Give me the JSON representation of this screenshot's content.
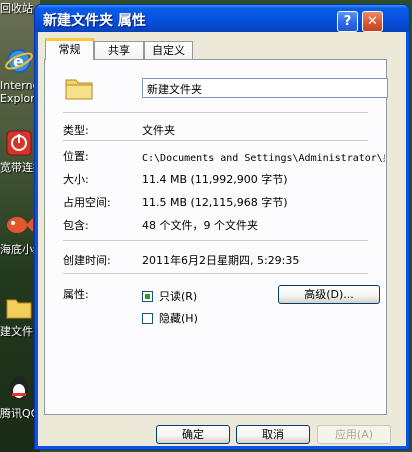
{
  "desktop": {
    "items": [
      {
        "label": "回收站",
        "icon": "recycle-bin-icon"
      },
      {
        "label": "Interne",
        "label2": "Explore",
        "icon": "internet-explorer-icon"
      },
      {
        "label": "宽带连接",
        "icon": "broadband-icon"
      },
      {
        "label": "海底小纵",
        "icon": "fish-icon"
      },
      {
        "label": "建文件",
        "icon": "folder-icon"
      },
      {
        "label": "腾讯QQ",
        "icon": "qq-icon"
      }
    ]
  },
  "window": {
    "title": "新建文件夹 属性",
    "buttons": {
      "help": "?",
      "close": "✕"
    }
  },
  "tabs": [
    {
      "label": "常规",
      "active": true
    },
    {
      "label": "共享",
      "active": false
    },
    {
      "label": "自定义",
      "active": false
    }
  ],
  "general": {
    "folder_name": "新建文件夹",
    "type_label": "类型:",
    "type_value": "文件夹",
    "location_label": "位置:",
    "location_value": "C:\\Documents and Settings\\Administrator\\桌",
    "size_label": "大小:",
    "size_value": "11.4 MB (11,992,900 字节)",
    "disk_label": "占用空间:",
    "disk_value": "11.5 MB (12,115,968 字节)",
    "contains_label": "包含:",
    "contains_value": "48 个文件，9 个文件夹",
    "created_label": "创建时间:",
    "created_value": "2011年6月2日星期四, 5:29:35",
    "attrs_label": "属性:",
    "readonly_label": "只读(R)",
    "readonly_checked": true,
    "hidden_label": "隐藏(H)",
    "hidden_checked": false,
    "advanced_button": "高级(D)..."
  },
  "footer": {
    "ok": "确定",
    "cancel": "取消",
    "apply": "应用(A)"
  },
  "colors": {
    "titlebar": "#0653df",
    "client": "#ece9d8",
    "tab_accent": "#ffc83c"
  }
}
